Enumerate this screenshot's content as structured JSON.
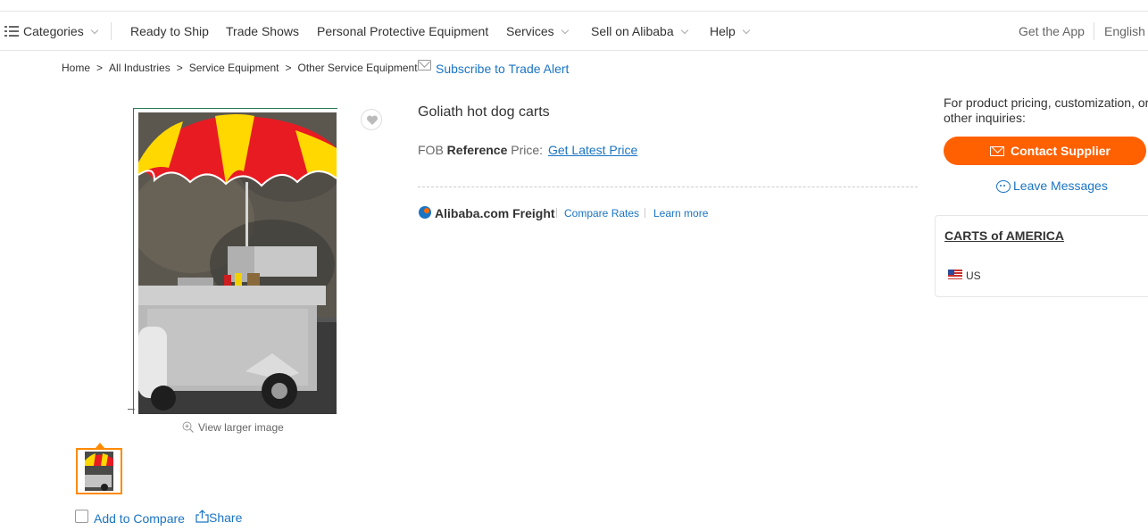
{
  "nav": {
    "categories": "Categories",
    "ready_to_ship": "Ready to Ship",
    "trade_shows": "Trade Shows",
    "ppe": "Personal Protective Equipment",
    "services": "Services",
    "sell": "Sell on Alibaba",
    "help": "Help",
    "get_app": "Get the App",
    "language": "English"
  },
  "breadcrumb": {
    "items": [
      "Home",
      "All Industries",
      "Service Equipment",
      "Other Service Equipment"
    ],
    "separator": ">",
    "subscribe": "Subscribe to Trade Alert"
  },
  "gallery": {
    "view_larger": "View larger image",
    "add_to_compare": "Add to Compare",
    "share": "Share"
  },
  "product": {
    "title": "Goliath hot dog carts",
    "price_prefix": "FOB",
    "price_bold": "Reference",
    "price_suffix": "Price:",
    "price_link": "Get Latest Price"
  },
  "freight": {
    "label": "Alibaba.com Freight",
    "compare_rates": "Compare Rates",
    "learn_more": "Learn more"
  },
  "sidebar": {
    "inquiry_text": "For product pricing, customization, or other inquiries:",
    "contact_button": "Contact Supplier",
    "leave_messages": "Leave Messages",
    "supplier_name": "CARTS of AMERICA",
    "country": "US"
  },
  "colors": {
    "accent_orange": "#ff6000",
    "link_blue": "#1a74c4"
  }
}
